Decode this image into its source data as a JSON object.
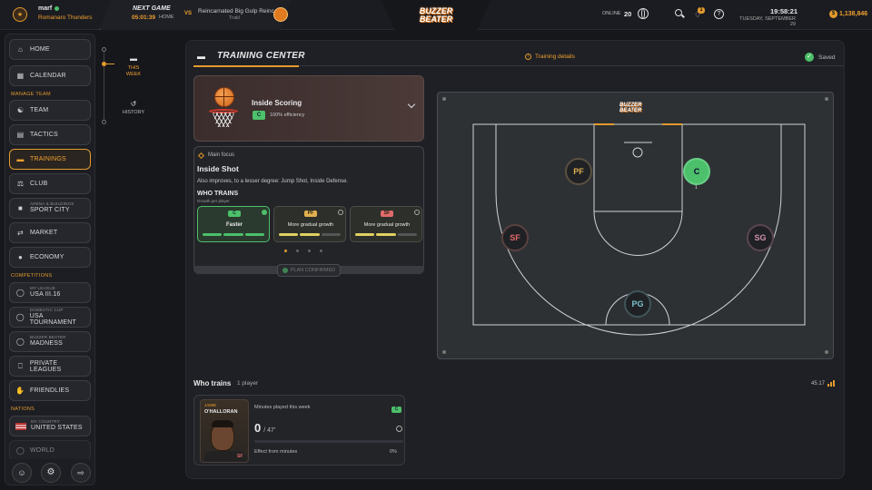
{
  "topbar": {
    "username": "marf",
    "team_name": "Romanaro Thunders",
    "next_game_label": "NEXT GAME",
    "countdown": "05:01:39",
    "venue": "HOME",
    "vs": "VS",
    "opponent_name": "Reincarnated Big Gulp Reinc",
    "opponent_sub": "Trakl",
    "logo_line1": "BUZZER",
    "logo_line2": "BEATER",
    "online_label": "ONLINE",
    "online_count": "20",
    "notif_count": "1",
    "clock": "19:58:21",
    "date": "TUESDAY, SEPTEMBER 29",
    "balance": "1,138,846"
  },
  "sidebar": {
    "home": "HOME",
    "calendar": "CALENDAR",
    "sec_manage": "MANAGE TEAM",
    "team": "TEAM",
    "tactics": "TACTICS",
    "trainings": "TRAININGS",
    "club": "CLUB",
    "sport_city_small": "ARENA & BUILDINGS",
    "sport_city": "SPORT CITY",
    "market": "MARKET",
    "economy": "ECONOMY",
    "sec_comp": "COMPETITIONS",
    "league_small": "MY LEAGUE",
    "league": "USA III.16",
    "cup_small": "DOMESTIC CUP",
    "cup": "USA TOURNAMENT",
    "bb_small": "BUZZER BEATER",
    "bb": "MADNESS",
    "private": "PRIVATE LEAGUES",
    "friendlies": "FRIENDLIES",
    "sec_nations": "NATIONS",
    "country_small": "MY COUNTRY",
    "country": "UNITED STATES",
    "world": "WORLD"
  },
  "week": {
    "this_week": "THIS WEEK",
    "history": "HISTORY"
  },
  "training": {
    "title": "TRAINING CENTER",
    "details": "Training details",
    "saved": "Saved",
    "focus_name": "Inside Scoring",
    "focus_badge": "C",
    "efficiency": "100% efficiency",
    "main_focus_label": "Main focus",
    "main_focus": "Inside Shot",
    "also_improves": "Also improves, to a lesser degree: Jump Shot, Inside Defense.",
    "who_trains_head": "WHO TRAINS",
    "growth_label": "Growth per player",
    "groups": [
      {
        "badge": "C",
        "label": "Faster"
      },
      {
        "badge": "PF",
        "label": "More gradual growth"
      },
      {
        "badge": "SF",
        "label": "More gradual growth"
      }
    ],
    "plan_confirmed": "PLAN CONFIRMED"
  },
  "court": {
    "logo_line1": "BUZZER",
    "logo_line2": "BEATER",
    "positions": [
      "PF",
      "C",
      "SF",
      "SG",
      "PG"
    ],
    "c_count": "1"
  },
  "who_trains": {
    "title": "Who trains",
    "count": "1 player",
    "stat": "45.17",
    "player_first": "JAMIE",
    "player_last": "O'HALLORAN",
    "player_pos": "SF",
    "minutes_label": "Minutes played this week",
    "minutes_badge": "C",
    "minutes": "0",
    "minutes_total": "/ 47'",
    "effect_label": "Effect from minutes",
    "effect_value": "0%"
  },
  "colors": {
    "accent": "#f0a030",
    "green": "#4cc06a",
    "pf_color": "#e0b050",
    "sf_color": "#e06a6a",
    "sg_color": "#d090b0",
    "pg_color": "#7ac0c8"
  }
}
